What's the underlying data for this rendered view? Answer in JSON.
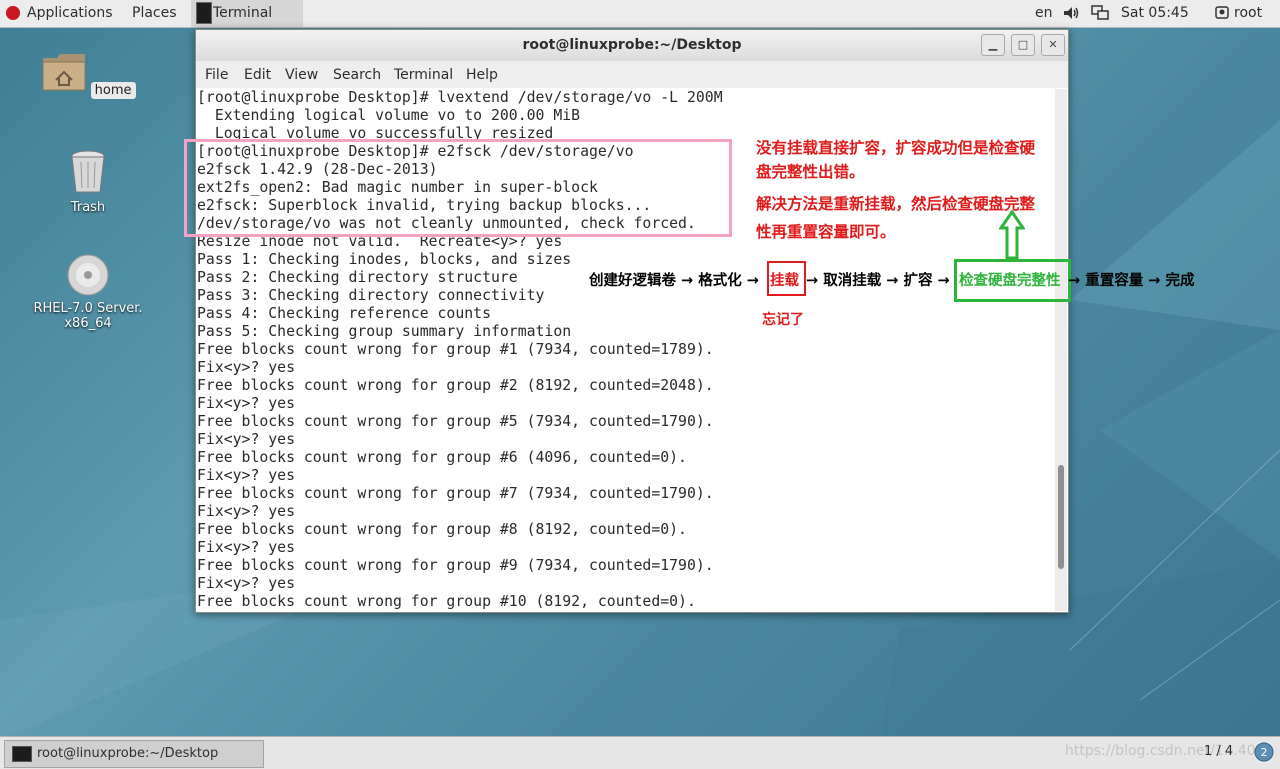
{
  "topbar": {
    "applications": "Applications",
    "places": "Places",
    "terminal": "Terminal",
    "lang": "en",
    "clock": "Sat 05:45",
    "user": "root"
  },
  "desktop": {
    "home_label": "home",
    "trash_label": "Trash",
    "dvd_label_1": "RHEL-7.0 Server.",
    "dvd_label_2": "x86_64"
  },
  "window": {
    "title": "root@linuxprobe:~/Desktop",
    "menu": [
      "File",
      "Edit",
      "View",
      "Search",
      "Terminal",
      "Help"
    ]
  },
  "terminal_lines": [
    "[root@linuxprobe Desktop]# lvextend /dev/storage/vo -L 200M",
    "  Extending logical volume vo to 200.00 MiB",
    "  Logical volume vo successfully resized",
    "[root@linuxprobe Desktop]# e2fsck /dev/storage/vo",
    "e2fsck 1.42.9 (28-Dec-2013)",
    "ext2fs_open2: Bad magic number in super-block",
    "e2fsck: Superblock invalid, trying backup blocks...",
    "/dev/storage/vo was not cleanly unmounted, check forced.",
    "Resize inode not valid.  Recreate<y>? yes",
    "Pass 1: Checking inodes, blocks, and sizes",
    "Pass 2: Checking directory structure",
    "Pass 3: Checking directory connectivity",
    "Pass 4: Checking reference counts",
    "Pass 5: Checking group summary information",
    "Free blocks count wrong for group #1 (7934, counted=1789).",
    "Fix<y>? yes",
    "Free blocks count wrong for group #2 (8192, counted=2048).",
    "Fix<y>? yes",
    "Free blocks count wrong for group #5 (7934, counted=1790).",
    "Fix<y>? yes",
    "Free blocks count wrong for group #6 (4096, counted=0).",
    "Fix<y>? yes",
    "Free blocks count wrong for group #7 (7934, counted=1790).",
    "Fix<y>? yes",
    "Free blocks count wrong for group #8 (8192, counted=0).",
    "Fix<y>? yes",
    "Free blocks count wrong for group #9 (7934, counted=1790).",
    "Fix<y>? yes",
    "Free blocks count wrong for group #10 (8192, counted=0)."
  ],
  "annotations": {
    "note_line1": "没有挂载直接扩容，扩容成功但是检查硬",
    "note_line2": "盘完整性出错。",
    "note_line3": "解决方法是重新挂载，然后检查硬盘完整",
    "note_line4": "性再重置容量即可。",
    "flow_1": "创建好逻辑卷 → 格式化 →",
    "flow_mount": "挂载",
    "flow_2": "→ 取消挂载 → 扩容 →",
    "flow_check": "检查硬盘完整性",
    "flow_3": "→ 重置容量 → 完成",
    "forgot": "忘记了"
  },
  "taskbar": {
    "task_title": "root@linuxprobe:~/Desktop",
    "workspace": "1 / 4",
    "watermark": "https://blog.csdn.net/1…40"
  },
  "colors": {
    "annotation_red": "#e01b1b",
    "annotation_green": "#2db43a",
    "highlight_pink": "#f5a3c0"
  }
}
